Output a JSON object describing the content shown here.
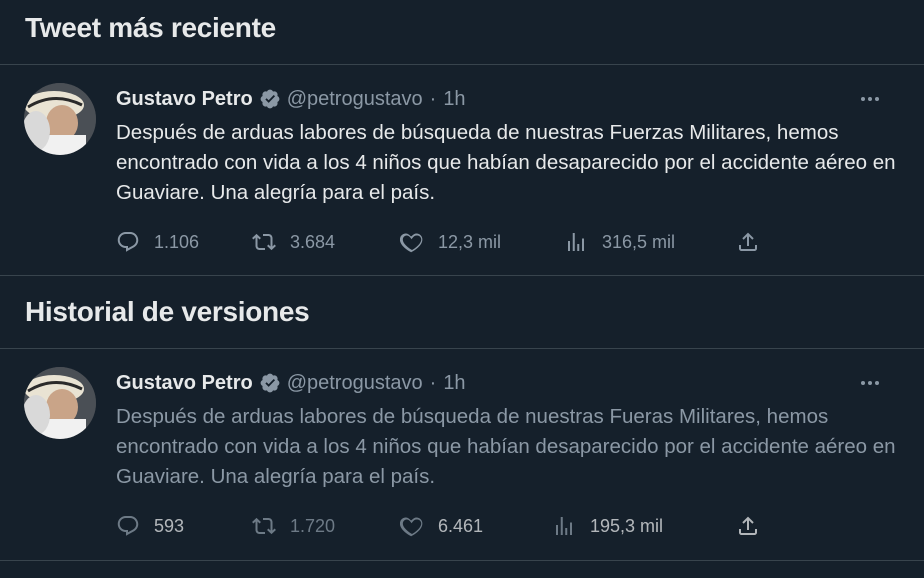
{
  "latest": {
    "title": "Tweet más reciente",
    "tweet": {
      "name": "Gustavo Petro",
      "handle": "@petrogustavo",
      "separator": "·",
      "time": "1h",
      "text": "Después de arduas labores de búsqueda de nuestras Fuerzas Militares, hemos encontrado con vida a los 4 niños que habían desaparecido por el accidente aéreo en Guaviare. Una alegría para el país.",
      "replies": "1.106",
      "retweets": "3.684",
      "likes": "12,3 mil",
      "views": "316,5 mil"
    }
  },
  "history": {
    "title": "Historial de versiones",
    "tweet": {
      "name": "Gustavo Petro",
      "handle": "@petrogustavo",
      "separator": "·",
      "time": "1h",
      "text": "Después de arduas labores de búsqueda de nuestras Fueras Militares, hemos encontrado con vida a los 4 niños que habían desaparecido por el accidente aéreo en Guaviare. Una alegría para el país.",
      "replies": "593",
      "retweets": "1.720",
      "likes": "6.461",
      "views": "195,3 mil"
    }
  },
  "colors": {
    "background": "#15202b",
    "text": "#e7e9ea",
    "muted": "#8b98a5",
    "divider": "#38444d",
    "verified": "#8b98a5"
  }
}
